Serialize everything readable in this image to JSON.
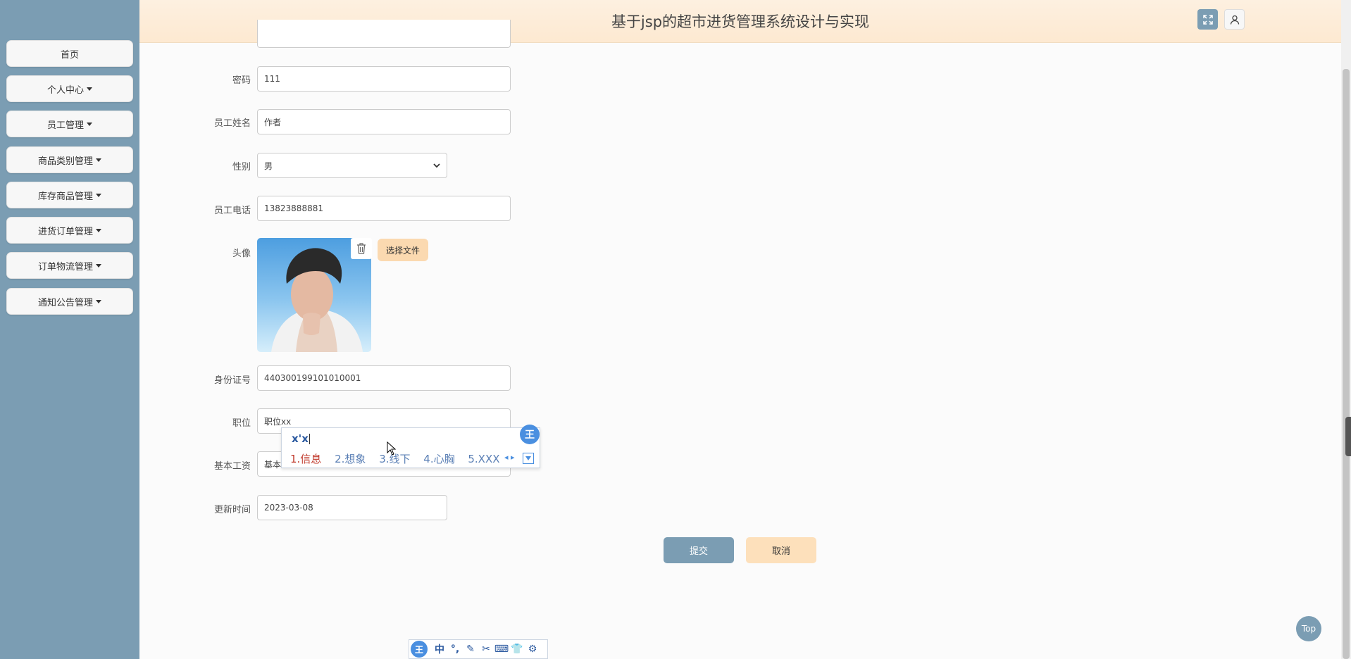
{
  "header": {
    "title": "基于jsp的超市进货管理系统设计与实现"
  },
  "sidebar": {
    "items": [
      {
        "label": "首页",
        "dropdown": false
      },
      {
        "label": "个人中心",
        "dropdown": true
      },
      {
        "label": "员工管理",
        "dropdown": true
      },
      {
        "label": "商品类别管理",
        "dropdown": true
      },
      {
        "label": "库存商品管理",
        "dropdown": true
      },
      {
        "label": "进货订单管理",
        "dropdown": true
      },
      {
        "label": "订单物流管理",
        "dropdown": true
      },
      {
        "label": "通知公告管理",
        "dropdown": true
      }
    ]
  },
  "form": {
    "password_label": "密码",
    "password_value": "111",
    "name_label": "员工姓名",
    "name_value": "作者",
    "gender_label": "性别",
    "gender_value": "男",
    "phone_label": "员工电话",
    "phone_value": "13823888881",
    "avatar_label": "头像",
    "choose_file_label": "选择文件",
    "idcard_label": "身份证号",
    "idcard_value": "440300199101010001",
    "position_label": "职位",
    "position_value": "职位xx",
    "salary_label": "基本工资",
    "salary_value": "基本",
    "update_label": "更新时间",
    "update_value": "2023-03-08",
    "submit_label": "提交",
    "cancel_label": "取消"
  },
  "ime": {
    "composition": "x'x",
    "logo": "王",
    "candidates": [
      "1.信息",
      "2.想象",
      "3.线下",
      "4.心胸",
      "5.XXX"
    ],
    "toolbar": [
      "中",
      "°,",
      "✎",
      "✂",
      "⌨",
      "👕",
      "⚙"
    ]
  },
  "top_label": "Top",
  "colors": {
    "sidebar": "#7b9db3",
    "header": "#fdebd4",
    "accent_orange": "#fbd9b0"
  }
}
